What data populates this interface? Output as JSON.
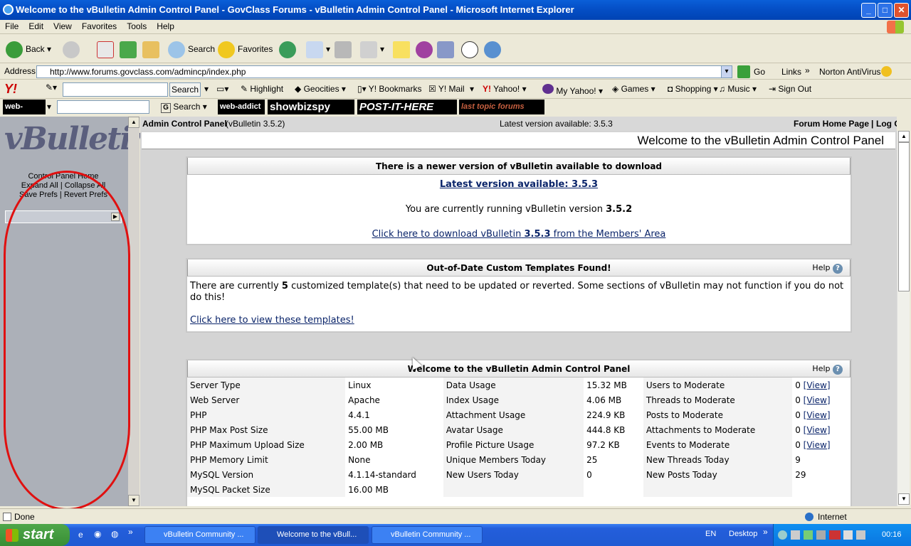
{
  "window": {
    "title": "Welcome to the vBulletin Admin Control Panel - GovClass Forums - vBulletin Admin Control Panel - Microsoft Internet Explorer",
    "minimize": "_",
    "maximize": "□",
    "close": "✕"
  },
  "menu": [
    "File",
    "Edit",
    "View",
    "Favorites",
    "Tools",
    "Help"
  ],
  "toolbar": {
    "back": "Back",
    "search": "Search",
    "favorites": "Favorites"
  },
  "address": {
    "label": "Address",
    "url": "http://www.forums.govclass.com/admincp/index.php",
    "go": "Go",
    "links": "Links",
    "norton": "Norton AntiVirus"
  },
  "yahoo": {
    "logo": "Y!",
    "search_button": "Search",
    "highlight": "Highlight",
    "geocities": "Geocities",
    "bookmarks": "Y! Bookmarks",
    "mail": "Y! Mail",
    "yahoo": "Yahoo!",
    "myyahoo": "My Yahoo!",
    "games": "Games",
    "shopping": "Shopping",
    "music": "Music",
    "signout": "Sign Out"
  },
  "webaddict": {
    "logo1": "web-addict",
    "search": "Search",
    "logo2": "web-addict",
    "showbiz": "showbizspy",
    "postit": "POST-IT-HERE",
    "lasttopic": "last topic forums"
  },
  "left": {
    "logo": "vBulletin",
    "control_panel_home": "Control Panel Home",
    "expand_all": "Expand All",
    "collapse_all": "Collapse All",
    "save_prefs": "Save Prefs",
    "revert_prefs": "Revert Prefs",
    "sep": "|"
  },
  "main": {
    "admin_cp": "Admin Control Panel",
    "version_note": "(vBulletin 3.5.2)",
    "latest_top": "Latest version available: 3.5.3",
    "forum_home": "Forum Home Page",
    "log_out": "Log Out",
    "sep": "|",
    "welcome_heading": "Welcome to the vBulletin Admin Control Panel"
  },
  "update_panel": {
    "title": "There is a newer version of vBulletin available to download",
    "latest_link": "Latest version available: 3.5.3",
    "running_prefix": "You are currently running vBulletin version",
    "running_version": "3.5.2",
    "download_prefix": "Click here to download vBulletin",
    "download_version": "3.5.3",
    "download_suffix": "from the Members' Area"
  },
  "templates_panel": {
    "title": "Out-of-Date Custom Templates Found!",
    "help": "Help",
    "text_prefix": "There are currently",
    "count": "5",
    "text_suffix": "customized template(s) that need to be updated or reverted. Some sections of vBulletin may not function if you do not do this!",
    "view_link": "Click here to view these templates!"
  },
  "stats_panel": {
    "title": "Welcome to the vBulletin Admin Control Panel",
    "help": "Help",
    "rows": [
      [
        "Server Type",
        "Linux",
        "Data Usage",
        "15.32 MB",
        "Users to Moderate",
        "0",
        "[View]"
      ],
      [
        "Web Server",
        "Apache",
        "Index Usage",
        "4.06 MB",
        "Threads to Moderate",
        "0",
        "[View]"
      ],
      [
        "PHP",
        "4.4.1",
        "Attachment Usage",
        "224.9 KB",
        "Posts to Moderate",
        "0",
        "[View]"
      ],
      [
        "PHP Max Post Size",
        "55.00 MB",
        "Avatar Usage",
        "444.8 KB",
        "Attachments to Moderate",
        "0",
        "[View]"
      ],
      [
        "PHP Maximum Upload Size",
        "2.00 MB",
        "Profile Picture Usage",
        "97.2 KB",
        "Events to Moderate",
        "0",
        "[View]"
      ],
      [
        "PHP Memory Limit",
        "None",
        "Unique Members Today",
        "25",
        "New Threads Today",
        "9",
        ""
      ],
      [
        "MySQL Version",
        "4.1.14-standard",
        "New Users Today",
        "0",
        "New Posts Today",
        "29",
        ""
      ],
      [
        "MySQL Packet Size",
        "16.00 MB",
        "",
        "",
        "",
        "",
        ""
      ]
    ]
  },
  "status": {
    "text": "Done",
    "zone": "Internet"
  },
  "taskbar": {
    "start": "start",
    "tasks": [
      "vBulletin Community ...",
      "Welcome to the vBull...",
      "vBulletin Community ..."
    ],
    "lang": "EN",
    "desktop": "Desktop",
    "clock": "00:16"
  }
}
